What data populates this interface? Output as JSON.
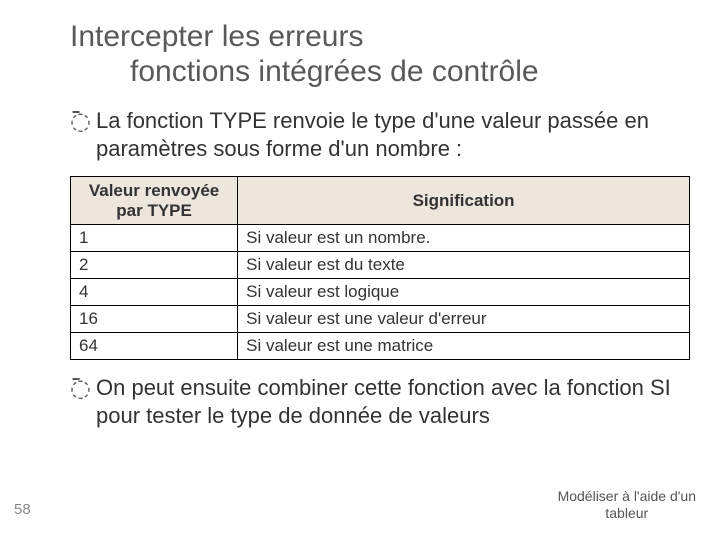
{
  "title": {
    "line1": "Intercepter les erreurs",
    "line2": "fonctions intégrées de contrôle"
  },
  "bullets": {
    "b1": "La fonction TYPE renvoie le type d'une valeur passée en paramètres sous forme d'un nombre :",
    "b2": "On peut ensuite combiner cette fonction avec la fonction SI pour tester le type de donnée de valeurs"
  },
  "bullet_marker": "߫",
  "table": {
    "headers": {
      "col1_line1": "Valeur renvoyée",
      "col1_line2": "par TYPE",
      "col2": "Signification"
    },
    "rows": [
      {
        "val": "1",
        "sig": "Si valeur est un nombre."
      },
      {
        "val": "2",
        "sig": "Si valeur est du texte"
      },
      {
        "val": "4",
        "sig": "Si valeur est logique"
      },
      {
        "val": "16",
        "sig": "Si valeur est une valeur d'erreur"
      },
      {
        "val": "64",
        "sig": "Si valeur est une matrice"
      }
    ]
  },
  "page_number": "58",
  "footer": {
    "line1": "Modéliser à l'aide d'un",
    "line2": "tableur"
  }
}
